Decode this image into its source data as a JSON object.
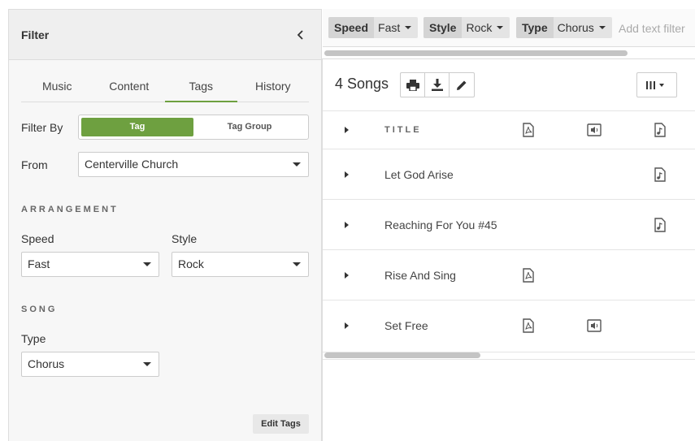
{
  "filter_panel": {
    "title": "Filter",
    "tabs": [
      {
        "label": "Music"
      },
      {
        "label": "Content"
      },
      {
        "label": "Tags",
        "active": true
      },
      {
        "label": "History"
      }
    ],
    "filter_by": {
      "label": "Filter By",
      "options": [
        "Tag",
        "Tag Group"
      ],
      "selected": "Tag"
    },
    "from": {
      "label": "From",
      "value": "Centerville Church"
    },
    "arrangement": {
      "heading": "ARRANGEMENT",
      "speed": {
        "label": "Speed",
        "value": "Fast"
      },
      "style": {
        "label": "Style",
        "value": "Rock"
      }
    },
    "song": {
      "heading": "SONG",
      "type": {
        "label": "Type",
        "value": "Chorus"
      }
    },
    "edit_tags_label": "Edit Tags"
  },
  "filter_bar": {
    "chips": [
      {
        "key": "Speed",
        "value": "Fast"
      },
      {
        "key": "Style",
        "value": "Rock"
      },
      {
        "key": "Type",
        "value": "Chorus"
      }
    ],
    "placeholder": "Add text filter"
  },
  "songs": {
    "count_label": "4 Songs",
    "header_title": "TITLE",
    "rows": [
      {
        "title": "Let God Arise",
        "pdf": false,
        "audio": false,
        "chart": true
      },
      {
        "title": "Reaching For You #45",
        "pdf": false,
        "audio": false,
        "chart": true
      },
      {
        "title": "Rise And Sing",
        "pdf": true,
        "audio": false,
        "chart": false
      },
      {
        "title": "Set Free",
        "pdf": true,
        "audio": true,
        "chart": false
      }
    ]
  },
  "icons": {
    "collapse": "chevron-left-icon",
    "print": "print-icon",
    "download": "download-icon",
    "edit": "pencil-icon",
    "columns": "columns-icon",
    "pdf": "pdf-file-icon",
    "audio": "audio-file-icon",
    "chart": "chord-chart-file-icon"
  },
  "colors": {
    "accent": "#6ea040"
  }
}
